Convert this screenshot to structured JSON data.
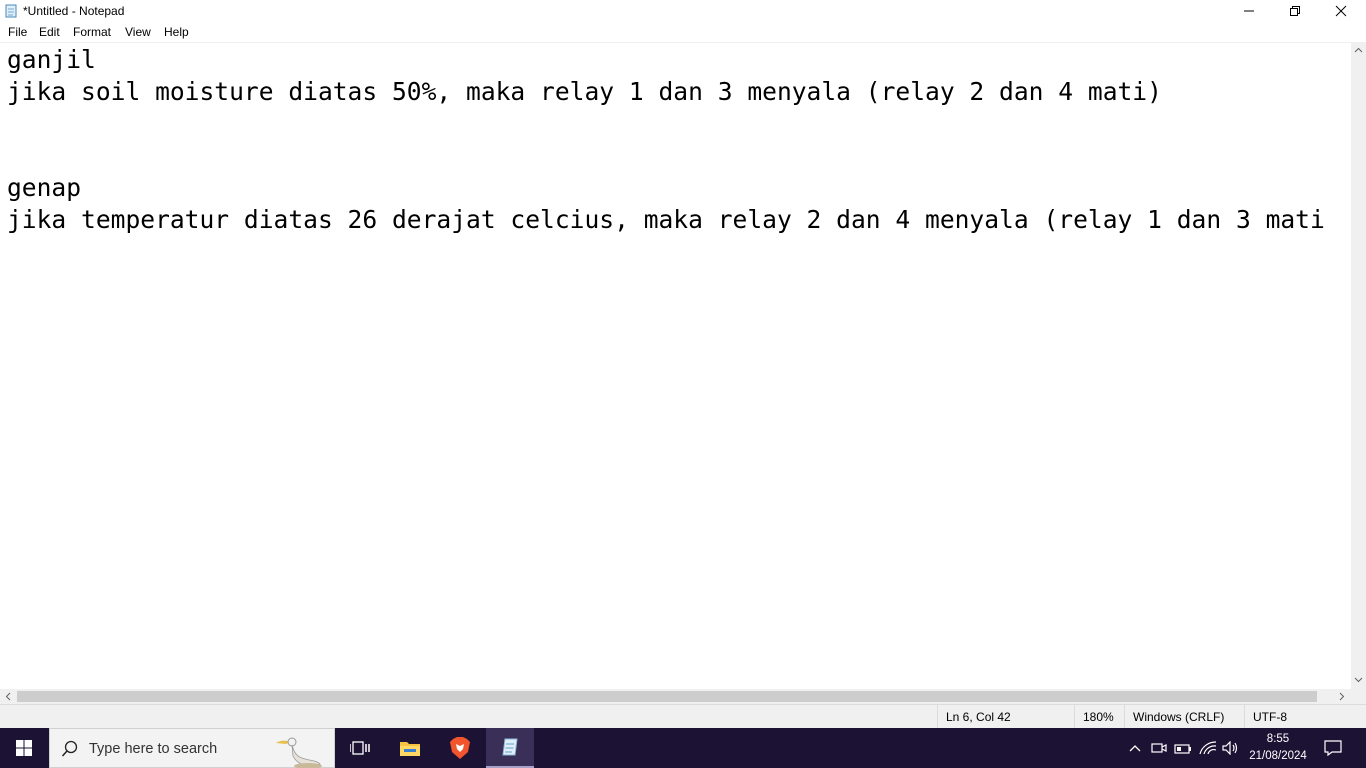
{
  "window": {
    "title": "*Untitled - Notepad",
    "icon": "notepad-icon",
    "controls": [
      "minimize-icon",
      "restore-icon",
      "close-icon"
    ]
  },
  "menu": {
    "items": [
      "File",
      "Edit",
      "Format",
      "View",
      "Help"
    ]
  },
  "editor": {
    "lines": [
      "ganjil",
      "jika soil moisture diatas 50%, maka relay 1 dan 3 menyala (relay 2 dan 4 mati)",
      "",
      "",
      "genap",
      "jika temperatur diatas 26 derajat celcius, maka relay 2 dan 4 menyala (relay 1 dan 3 mati"
    ]
  },
  "status": {
    "position": "Ln 6, Col 42",
    "zoom": "180%",
    "line_ending": "Windows (CRLF)",
    "encoding": "UTF-8"
  },
  "taskbar": {
    "search_placeholder": "Type here to search",
    "apps": [
      "start-icon",
      "task-view-icon",
      "file-explorer-icon",
      "brave-browser-icon",
      "notepad-icon"
    ],
    "tray_icons": [
      "chevron-up-icon",
      "meet-now-icon",
      "battery-icon",
      "wifi-icon",
      "volume-icon",
      "notifications-icon"
    ],
    "time": "8:55",
    "date": "21/08/2024"
  },
  "colors": {
    "taskbar_bg": "#1b1234",
    "statusbar_bg": "#f0f0f0",
    "brave": "#f2542d",
    "explorer_folder": "#f5c342"
  }
}
